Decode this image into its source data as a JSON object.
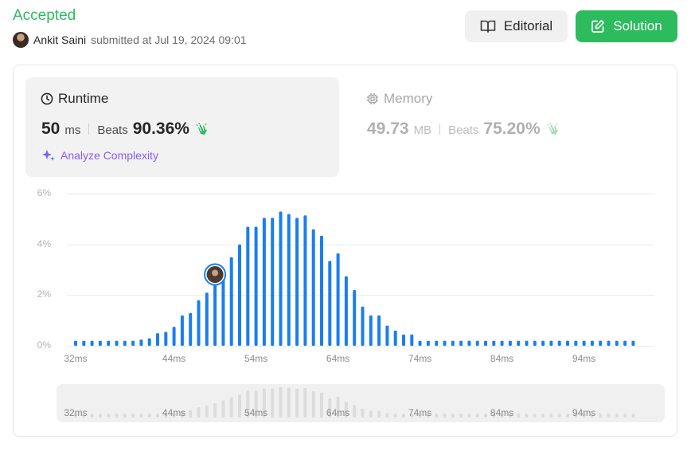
{
  "header": {
    "status": "Accepted",
    "user_name": "Ankit Saini",
    "submitted_text": "submitted at Jul 19, 2024 09:01",
    "editorial_label": "Editorial",
    "solution_label": "Solution"
  },
  "runtime": {
    "title": "Runtime",
    "value": "50",
    "unit": "ms",
    "beats_label": "Beats",
    "beats_value": "90.36%",
    "analyze_label": "Analyze Complexity"
  },
  "memory": {
    "title": "Memory",
    "value": "49.73",
    "unit": "MB",
    "beats_label": "Beats",
    "beats_value": "75.20%"
  },
  "colors": {
    "accent_green": "#2cbb5d",
    "bar_blue": "#1a7ef0",
    "overview_bar": "#dcdcdc",
    "analyze_purple": "#8a5cf0"
  },
  "chart_data": {
    "type": "bar",
    "y_ticks": [
      "6%",
      "4%",
      "2%",
      "0%"
    ],
    "ylim": [
      0,
      6
    ],
    "x_ticks": [
      "32ms",
      "44ms",
      "54ms",
      "64ms",
      "74ms",
      "84ms",
      "94ms"
    ],
    "x_tick_values": [
      32,
      44,
      54,
      64,
      74,
      84,
      94
    ],
    "x": [
      32,
      33,
      34,
      35,
      36,
      37,
      38,
      39,
      40,
      41,
      42,
      43,
      44,
      45,
      46,
      47,
      48,
      49,
      50,
      51,
      52,
      53,
      54,
      55,
      56,
      57,
      58,
      59,
      60,
      61,
      62,
      63,
      64,
      65,
      66,
      67,
      68,
      69,
      70,
      71,
      72,
      73,
      74,
      75,
      76,
      77,
      78,
      79,
      80,
      81,
      82,
      83,
      84,
      85,
      86,
      87,
      88,
      89,
      90,
      91,
      92,
      93,
      94,
      95,
      96,
      97,
      98,
      99,
      100
    ],
    "values": [
      0.2,
      0.2,
      0.2,
      0.2,
      0.2,
      0.2,
      0.2,
      0.2,
      0.25,
      0.3,
      0.5,
      0.55,
      0.75,
      1.2,
      1.3,
      1.8,
      2.1,
      2.5,
      3.0,
      3.5,
      4.0,
      4.7,
      4.7,
      5.05,
      5.05,
      5.3,
      5.2,
      5.05,
      5.15,
      4.6,
      4.35,
      3.35,
      3.65,
      2.75,
      2.2,
      1.55,
      1.2,
      1.2,
      0.8,
      0.6,
      0.45,
      0.45,
      0.2,
      0.2,
      0.2,
      0.2,
      0.2,
      0.2,
      0.2,
      0.2,
      0.2,
      0.2,
      0.2,
      0.2,
      0.2,
      0.2,
      0.2,
      0.2,
      0.2,
      0.2,
      0.2,
      0.2,
      0.2,
      0.2,
      0.2,
      0.2,
      0.2,
      0.2,
      0.2
    ],
    "user_marker_x": 49,
    "grid": true
  }
}
